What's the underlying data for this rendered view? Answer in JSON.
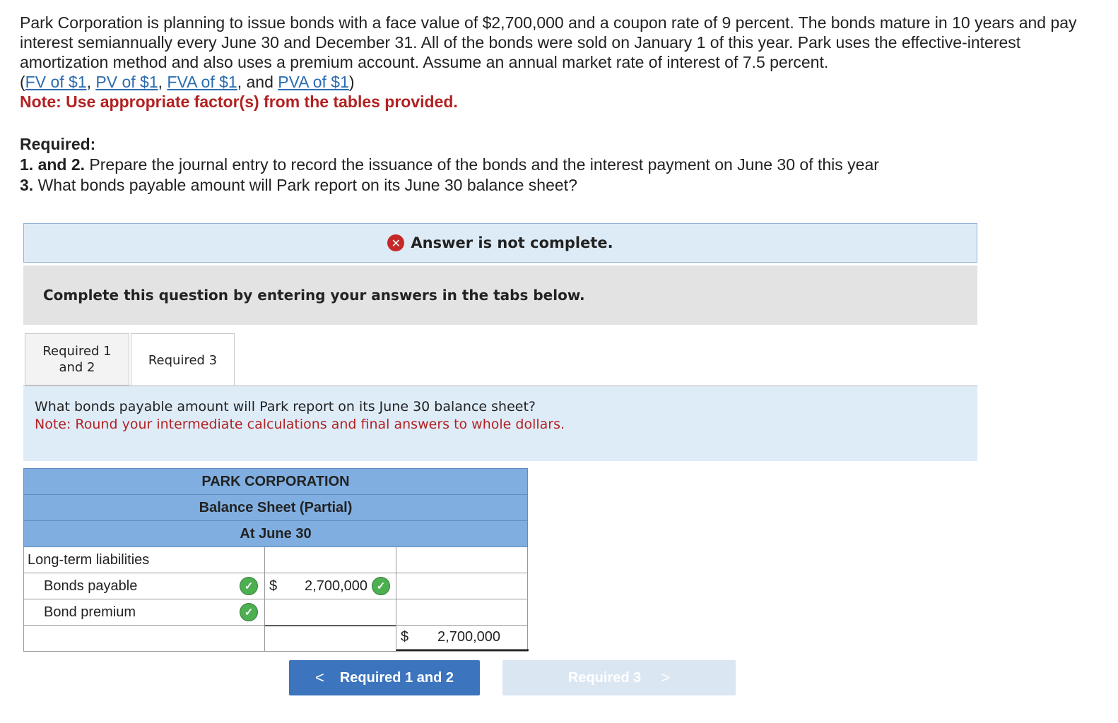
{
  "problem": {
    "text_1": "Park Corporation is planning to issue bonds with a face value of $2,700,000 and a coupon rate of 9 percent. The bonds mature in 10 years and pay interest semiannually every June 30 and December 31. All of the bonds were sold on January 1 of this year. Park uses the effective-interest amortization method and also uses a premium account. Assume an annual market rate of interest of 7.5 percent.",
    "open_paren": "(",
    "link_fv": "FV of $1",
    "sep1": ", ",
    "link_pv": "PV of $1",
    "sep2": ", ",
    "link_fva": "FVA of $1",
    "sep3": ", and ",
    "link_pva": "PVA of $1",
    "close_paren": ")",
    "note": "Note: Use appropriate factor(s) from the tables provided."
  },
  "required": {
    "heading": "Required:",
    "item1_num": "1. and 2.",
    "item1_text": " Prepare the journal entry to record the issuance of the bonds and the interest payment on June 30 of this year",
    "item2_num": "3.",
    "item2_text": " What bonds payable amount will Park report on its June 30 balance sheet?"
  },
  "banner": {
    "icon": "x-circle-icon",
    "text": "Answer is not complete."
  },
  "instruction": "Complete this question by entering your answers in the tabs below.",
  "tabs": [
    {
      "line1": "Required 1",
      "line2": "and 2"
    },
    {
      "line1": "Required 3"
    }
  ],
  "question": {
    "text": "What bonds payable amount will Park report on its June 30 balance sheet?",
    "note": "Note: Round your intermediate calculations and final answers to whole dollars."
  },
  "balance_sheet": {
    "title1": "PARK CORPORATION",
    "title2": "Balance Sheet (Partial)",
    "title3": "At June 30",
    "section": "Long-term liabilities",
    "rows": [
      {
        "label": "Bonds payable",
        "dollar": "$",
        "amount": "2,700,000"
      },
      {
        "label": "Bond premium",
        "amount": ""
      }
    ],
    "total_dollar": "$",
    "total": "2,700,000"
  },
  "nav": {
    "prev_label": "Required 1 and 2",
    "next_label": "Required 3",
    "prev_chevron": "<",
    "next_chevron": ">"
  }
}
